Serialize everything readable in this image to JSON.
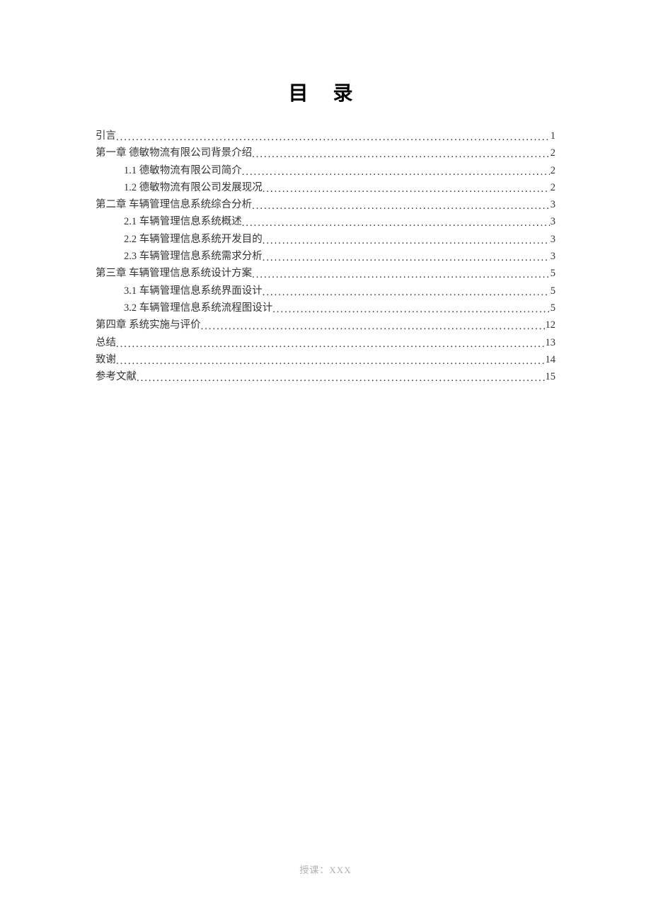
{
  "title": "目 录",
  "toc": {
    "items": [
      {
        "label": "引言",
        "page": "1",
        "indent": 0
      },
      {
        "label": "第一章  德敏物流有限公司背景介绍",
        "page": "2",
        "indent": 0
      },
      {
        "label": "1.1 德敏物流有限公司简介",
        "page": "2",
        "indent": 1
      },
      {
        "label": "1.2 德敏物流有限公司发展现况",
        "page": "2",
        "indent": 1
      },
      {
        "label": "第二章  车辆管理信息系统综合分析",
        "page": "3",
        "indent": 0
      },
      {
        "label": "2.1 车辆管理信息系统概述",
        "page": "3",
        "indent": 1
      },
      {
        "label": "2.2 车辆管理信息系统开发目的",
        "page": "3",
        "indent": 1
      },
      {
        "label": "2.3 车辆管理信息系统需求分析",
        "page": "3",
        "indent": 1
      },
      {
        "label": "第三章  车辆管理信息系统设计方案",
        "page": "5",
        "indent": 0
      },
      {
        "label": "3.1 车辆管理信息系统界面设计",
        "page": "5",
        "indent": 1
      },
      {
        "label": "3.2 车辆管理信息系统流程图设计",
        "page": "5",
        "indent": 1
      },
      {
        "label": "第四章  系统实施与评价",
        "page": "12",
        "indent": 0
      },
      {
        "label": "总结",
        "page": "13",
        "indent": 0
      },
      {
        "label": "致谢",
        "page": "14",
        "indent": 0
      },
      {
        "label": "参考文献",
        "page": "15",
        "indent": 0
      }
    ]
  },
  "footer": "授课：XXX"
}
